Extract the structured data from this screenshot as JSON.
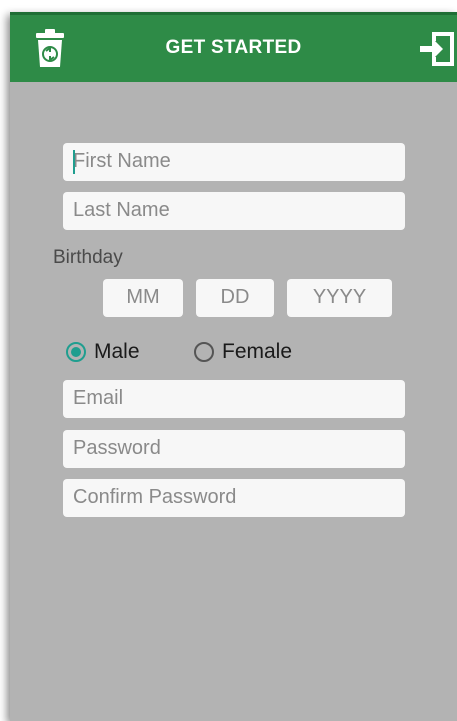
{
  "app_bar": {
    "title": "GET STARTED",
    "left_icon": "recycle-bin-icon",
    "right_icon": "sign-in-icon",
    "color": "#2e8b47"
  },
  "form": {
    "first_name": {
      "placeholder": "First Name",
      "value": ""
    },
    "last_name": {
      "placeholder": "Last Name",
      "value": ""
    },
    "birthday_label": "Birthday",
    "birthday": {
      "month_placeholder": "MM",
      "day_placeholder": "DD",
      "year_placeholder": "YYYY"
    },
    "gender": {
      "options": [
        "Male",
        "Female"
      ],
      "selected": "Male"
    },
    "email": {
      "placeholder": "Email",
      "value": ""
    },
    "password": {
      "placeholder": "Password",
      "value": ""
    },
    "confirm_password": {
      "placeholder": "Confirm Password",
      "value": ""
    }
  },
  "colors": {
    "background": "#b3b3b3",
    "field": "#f7f7f7",
    "accent": "#1f9e8f"
  }
}
